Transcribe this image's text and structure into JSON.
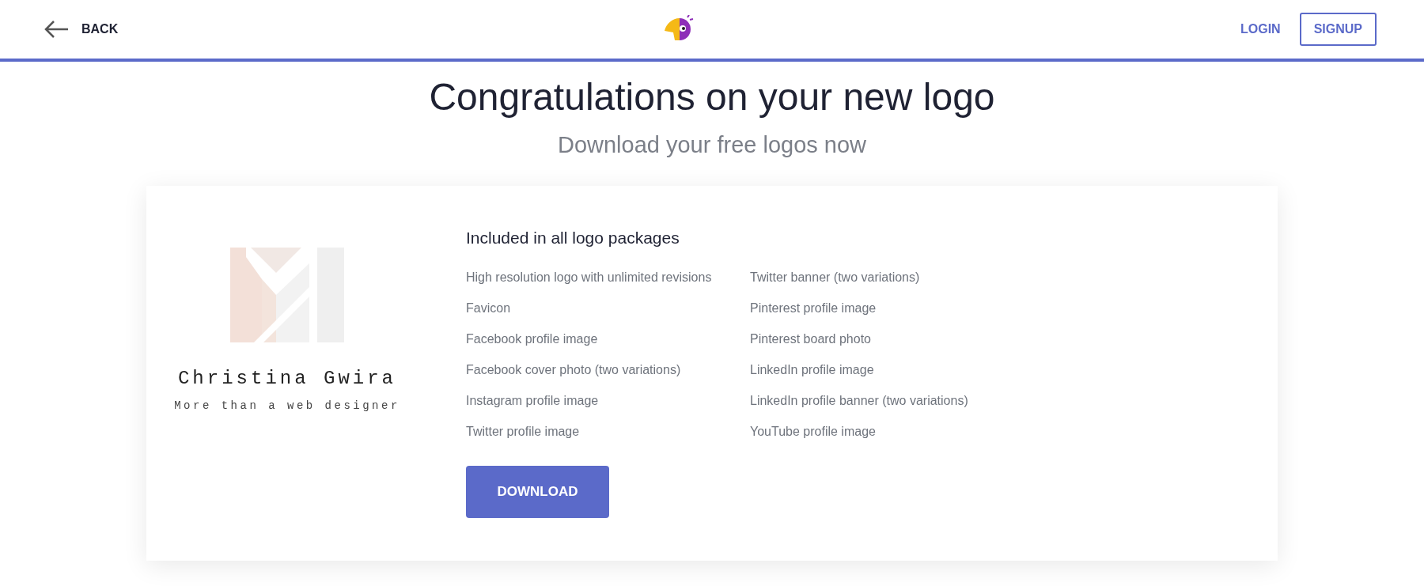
{
  "header": {
    "back_label": "BACK",
    "login": "LOGIN",
    "signup": "SIGNUP"
  },
  "title": "Congratulations on your new logo",
  "subtitle": "Download your free logos now",
  "logo_preview": {
    "name": "Christina Gwira",
    "tagline": "More than a web designer"
  },
  "package": {
    "heading": "Included in all logo packages",
    "columns": [
      [
        "High resolution logo with unlimited revisions",
        "Favicon",
        "Facebook profile image",
        "Facebook cover photo (two variations)",
        "Instagram profile image",
        "Twitter profile image"
      ],
      [
        "Twitter banner (two variations)",
        "Pinterest profile image",
        "Pinterest board photo",
        "LinkedIn profile image",
        "LinkedIn profile banner (two variations)",
        "YouTube profile image"
      ]
    ]
  },
  "download_button": "DOWNLOAD"
}
